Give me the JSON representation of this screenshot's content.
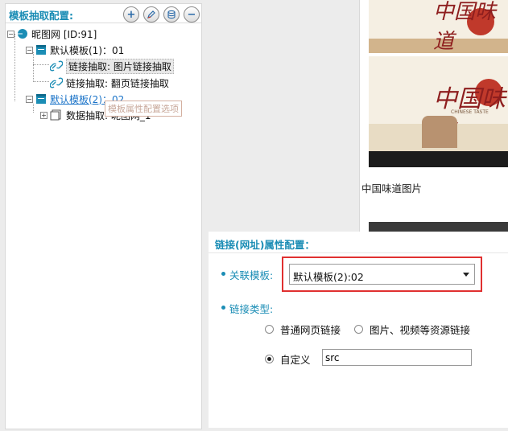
{
  "left_panel": {
    "title": "模板抽取配置:",
    "toolbar": {
      "add": "+",
      "remove": "−"
    }
  },
  "tree": {
    "root": "昵图网 [ID:91]",
    "template1": "默认模板(1)：01",
    "link_extract_image": "链接抽取: 图片链接抽取",
    "link_extract_page": "链接抽取: 翻页链接抽取",
    "template2": "默认模板(2)：02",
    "data_extract": "数据抽取: 昵图网_1",
    "tooltip": "模板属性配置选项"
  },
  "preview": {
    "caption": "中国味道图片",
    "poster_title": "中国味道",
    "poster_sub": "CHINESE TASTE"
  },
  "config": {
    "title": "链接(网址)属性配置：",
    "template_label": "关联模板:",
    "template_value": "默认模板(2):02",
    "link_type_label": "链接类型:",
    "option_normal": "普通网页链接",
    "option_resource": "图片、视频等资源链接",
    "option_custom": "自定义",
    "custom_value": "src"
  },
  "colors": {
    "accent": "#1b8db5",
    "highlight": "#e03030"
  }
}
